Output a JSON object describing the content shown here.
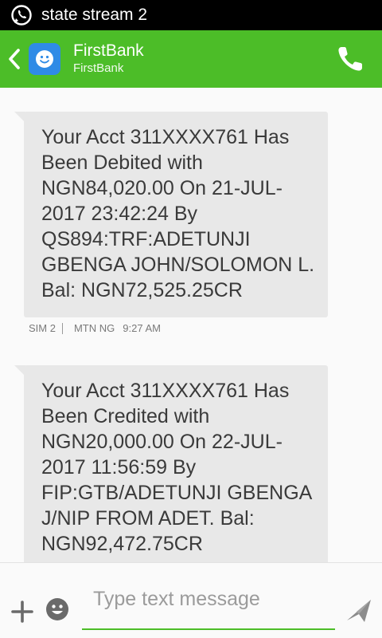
{
  "status_bar": {
    "app_icon": "whatsapp-icon",
    "title": "state stream 2"
  },
  "header": {
    "contact_name": "FirstBank",
    "contact_sub": "FirstBank",
    "icons": [
      "back-chevron-icon",
      "contact-avatar-icon",
      "phone-call-icon"
    ],
    "color": "#4cbd28"
  },
  "messages": [
    {
      "text": "Your Acct 311XXXX761 Has Been Debited with NGN84,020.00 On 21-JUL-2017 23:42:24 By QS894:TRF:ADETUNJI GBENGA JOHN/SOLOMON L. Bal: NGN72,525.25CR",
      "sim": "SIM 2",
      "carrier": "MTN NG",
      "time": "9:27 AM"
    },
    {
      "text": "Your Acct 311XXXX761 Has Been Credited with NGN20,000.00 On 22-JUL-2017 11:56:59 By FIP:GTB/ADETUNJI GBENGA J/NIP FROM ADET. Bal: NGN92,472.75CR"
    }
  ],
  "compose": {
    "placeholder": "Type text message",
    "value": "",
    "icons": [
      "plus-icon",
      "emoji-icon",
      "send-icon"
    ]
  }
}
